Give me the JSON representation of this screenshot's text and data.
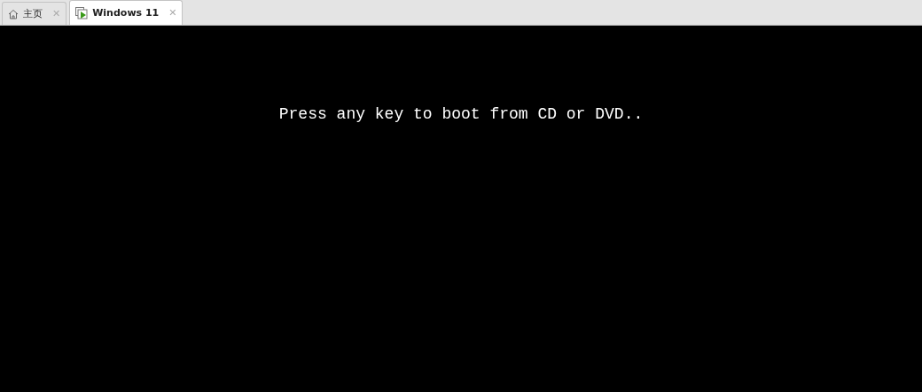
{
  "tabs": [
    {
      "label": "主页",
      "kind": "home",
      "selected": false,
      "close": "✕"
    },
    {
      "label": "Windows 11",
      "kind": "vm",
      "selected": true,
      "close": "✕"
    }
  ],
  "console": {
    "message": "Press any key to boot from CD or DVD.."
  }
}
